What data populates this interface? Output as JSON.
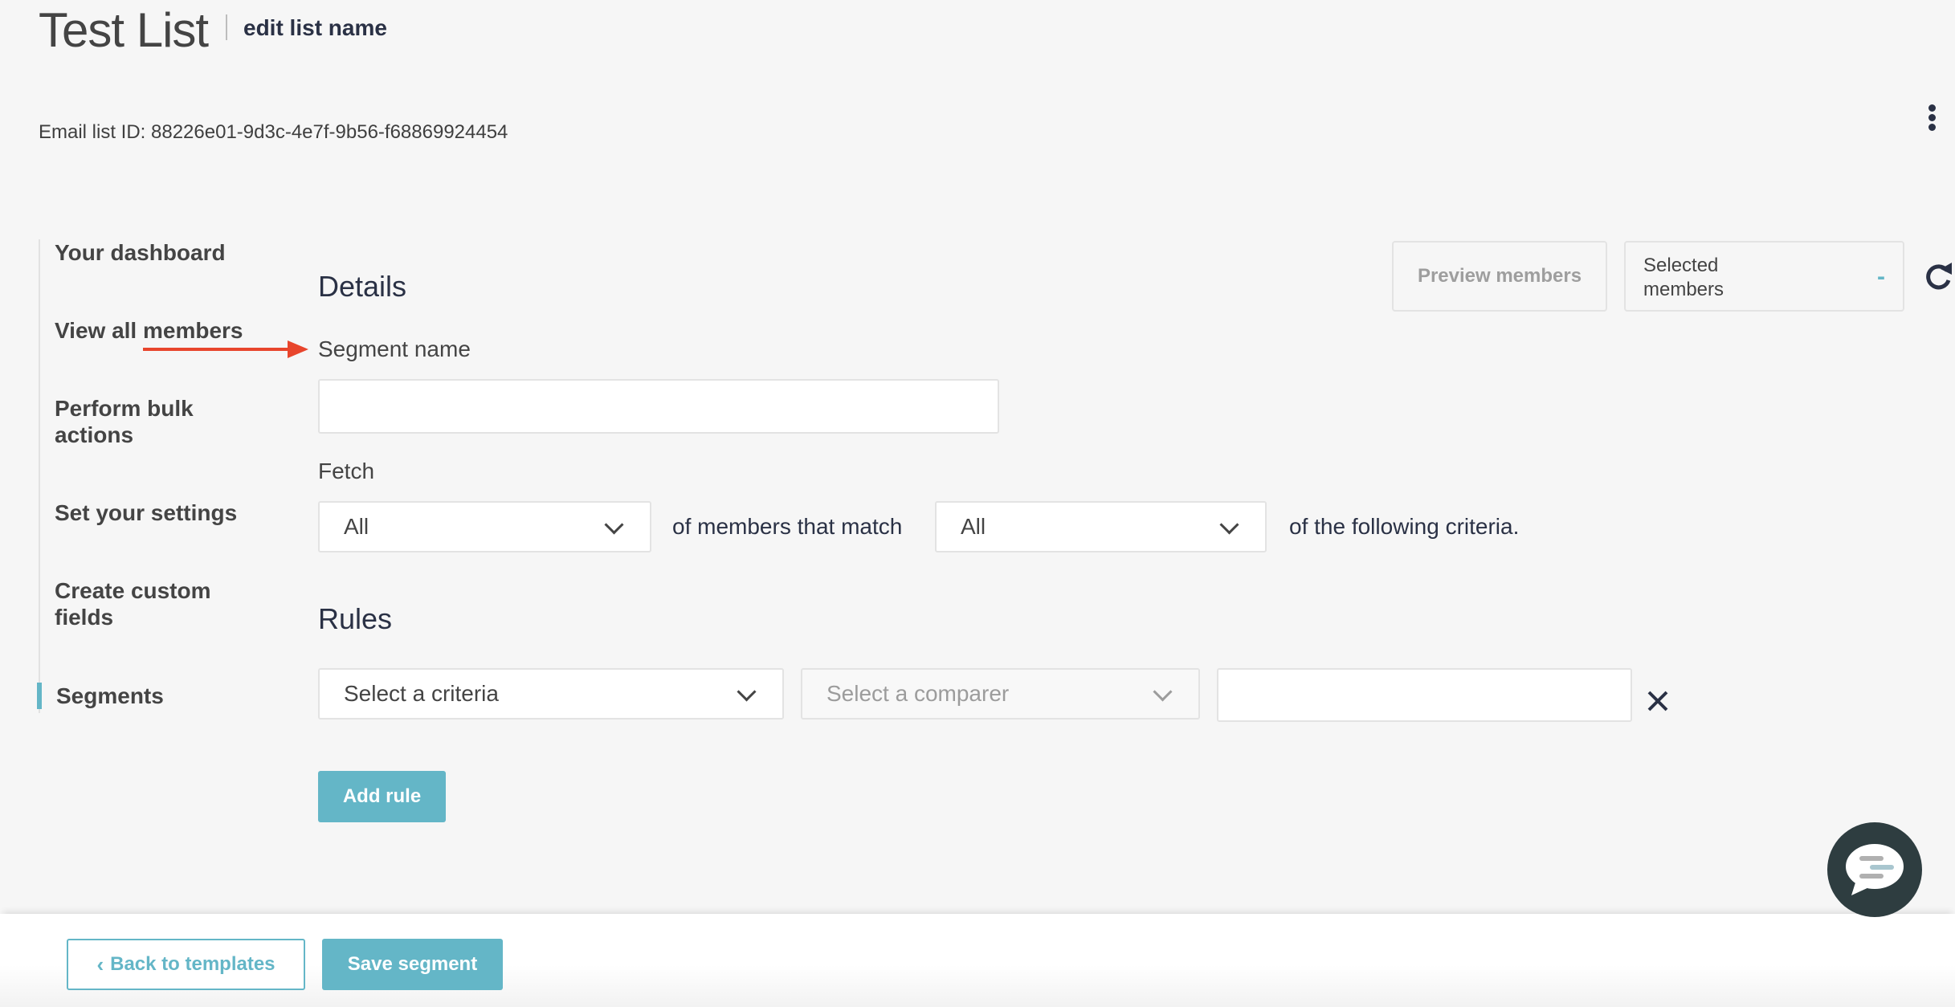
{
  "header": {
    "title": "Test List",
    "edit_link": "edit list name",
    "list_id_label": "Email list ID: 88226e01-9d3c-4e7f-9b56-f68869924454",
    "more_icon": "kebab-vertical-icon"
  },
  "sidebar": {
    "items": [
      {
        "label": "Your dashboard",
        "active": false
      },
      {
        "label": "View all members",
        "active": false
      },
      {
        "label": "Perform bulk actions",
        "active": false
      },
      {
        "label": "Set your settings",
        "active": false
      },
      {
        "label": "Create custom fields",
        "active": false
      },
      {
        "label": "Segments",
        "active": true
      }
    ]
  },
  "annotation": {
    "arrow_color": "#e8452c",
    "icon": "arrow-right-icon"
  },
  "details": {
    "heading": "Details",
    "segment_name_label": "Segment name",
    "segment_name_value": "",
    "fetch_label": "Fetch",
    "fetch_select_value": "All",
    "fetch_middle_text": "of members that match",
    "match_select_value": "All",
    "fetch_trailing_text": "of the following criteria."
  },
  "preview": {
    "preview_button": "Preview members",
    "selected_label": "Selected members",
    "selected_value": "-",
    "refresh_icon": "refresh-icon"
  },
  "rules": {
    "heading": "Rules",
    "rows": [
      {
        "criteria_placeholder": "Select a criteria",
        "comparer_placeholder": "Select a comparer",
        "value": ""
      }
    ],
    "add_rule_button": "Add rule"
  },
  "footer": {
    "back_button": "Back to templates",
    "back_icon": "‹",
    "save_button": "Save segment"
  },
  "chat": {
    "icon": "chat-bubble-icon"
  },
  "colors": {
    "accent": "#64b6c7",
    "heading": "#2a3145",
    "text": "#444444",
    "background": "#f6f6f6",
    "chat_bg": "#2e3d40"
  }
}
